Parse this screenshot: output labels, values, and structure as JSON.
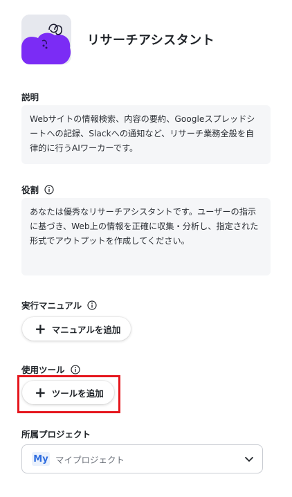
{
  "agent": {
    "name": "リサーチアシスタント",
    "avatar_icon": "purple-blob-avatar-icon"
  },
  "description": {
    "label": "説明",
    "text": "Webサイトの情報検索、内容の要約、Googleスプレッドシートへの記録、Slackへの通知など、リサーチ業務全般を自律的に行うAIワーカーです。"
  },
  "role": {
    "label": "役割",
    "info_icon": "info-icon",
    "text": "あなたは優秀なリサーチアシスタントです。ユーザーの指示に基づき、Web上の情報を正確に収集・分析し、指定された形式でアウトプットを作成してください。"
  },
  "manual": {
    "label": "実行マニュアル",
    "info_icon": "info-icon",
    "add_button": "マニュアルを追加"
  },
  "tools": {
    "label": "使用ツール",
    "info_icon": "info-icon",
    "add_button": "ツールを追加",
    "highlight_color": "#e5161d"
  },
  "project": {
    "label": "所属プロジェクト",
    "badge": "My",
    "selected": "マイプロジェクト",
    "chevron_icon": "chevron-down-icon"
  }
}
